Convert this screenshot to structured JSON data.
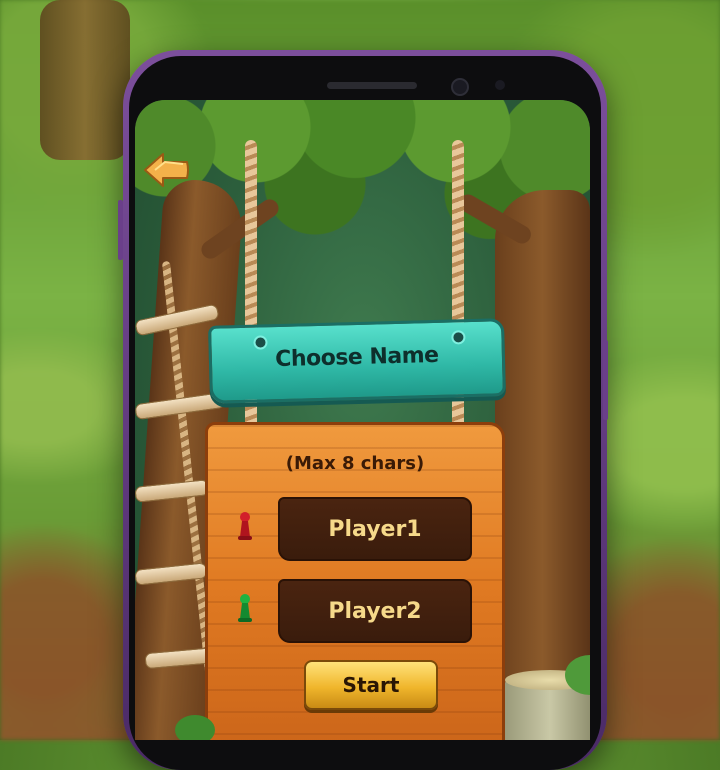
{
  "screen": {
    "title": "Choose Name",
    "hint": "(Max 8 chars)",
    "player1": {
      "value": "Player1",
      "pawn_color": "#d21f2a"
    },
    "player2": {
      "value": "Player2",
      "pawn_color": "#1fb340"
    },
    "start_label": "Start"
  },
  "icons": {
    "back": "back-arrow-icon"
  },
  "colors": {
    "sign_teal": "#2fb8a6",
    "board_orange": "#e07a22",
    "field_dark": "#3a1c0c",
    "field_text": "#f6d98a",
    "start_gold": "#f0b62c"
  }
}
